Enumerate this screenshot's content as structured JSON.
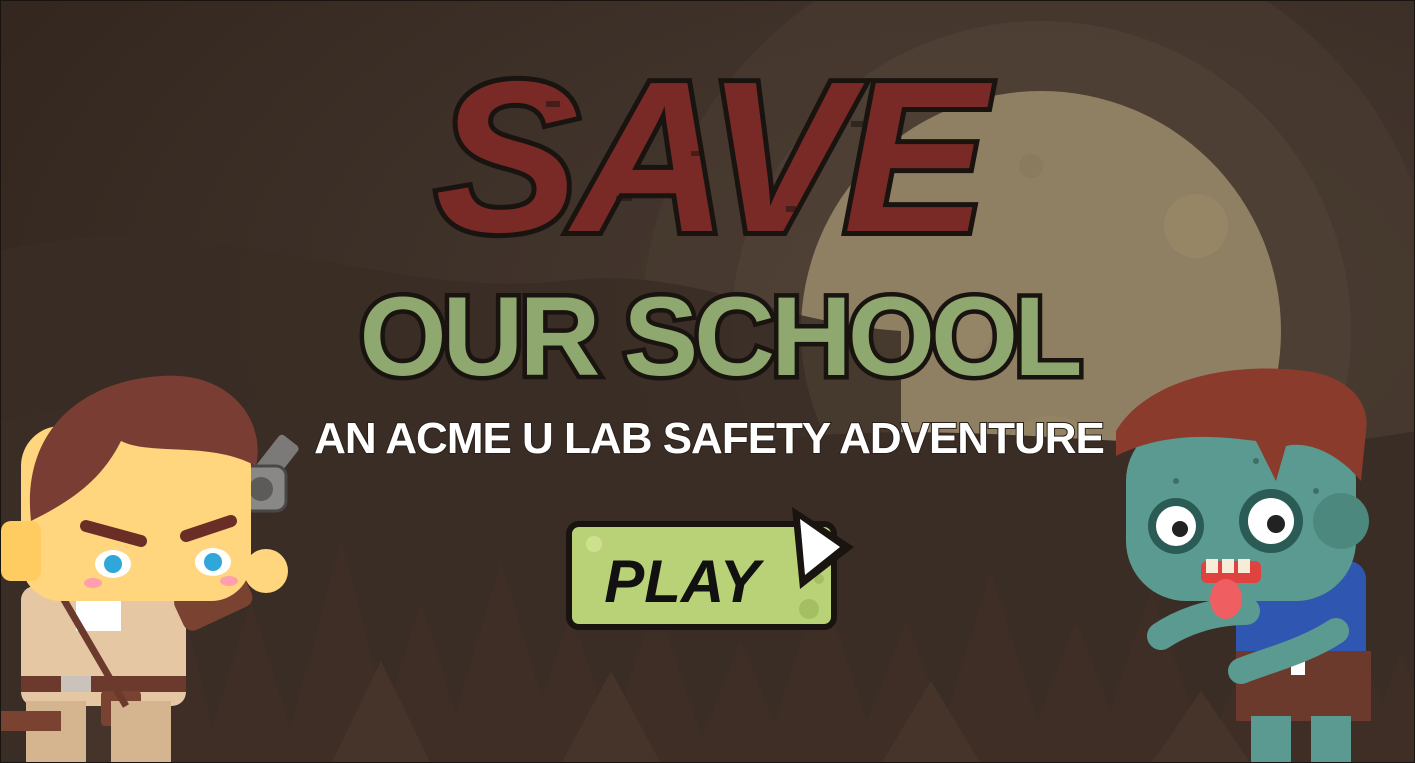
{
  "game": {
    "title_line1": "SAVE",
    "title_line2": "OUR SCHOOL",
    "subtitle": "AN ACME U LAB SAFETY ADVENTURE",
    "play_label": "PLAY"
  },
  "colors": {
    "background": "#3d3029",
    "moon": "#8f8064",
    "title_red": "#7a2a26",
    "title_green": "#8fa870",
    "play_button": "#b9d277",
    "outline": "#1a1410"
  },
  "icons": {
    "play": "play-triangle-icon",
    "moon": "moon",
    "trees": "pine-tree-silhouettes",
    "hero": "hero-character-with-revolver",
    "zombie": "zombie-character"
  }
}
